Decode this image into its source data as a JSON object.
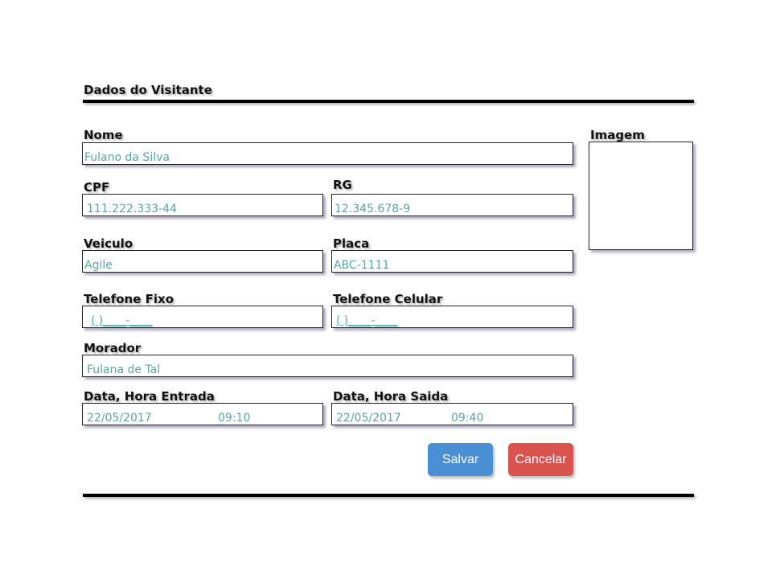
{
  "section_title": "Dados do Visitante",
  "image_label": "Imagem",
  "fields": {
    "nome": {
      "label": "Nome",
      "value": "Fulano da Silva"
    },
    "cpf": {
      "label": "CPF",
      "value": "111.222.333-44"
    },
    "rg": {
      "label": "RG",
      "value": "12.345.678-9"
    },
    "veiculo": {
      "label": "Veiculo",
      "value": "Agile"
    },
    "placa": {
      "label": "Placa",
      "value": "ABC-1111"
    },
    "telefone_fixo": {
      "label": "Telefone Fixo",
      "value": "( )____-____"
    },
    "telefone_celular": {
      "label": "Telefone Celular",
      "value": "( )____-____"
    },
    "morador": {
      "label": "Morador",
      "value": "Fulana de Tal"
    },
    "entrada": {
      "label": "Data, Hora Entrada",
      "date": "22/05/2017",
      "time": "09:10"
    },
    "saida": {
      "label": "Data, Hora Saida",
      "date": "22/05/2017",
      "time": "09:40"
    }
  },
  "buttons": {
    "save": {
      "label": "Salvar",
      "color": "#4a8fd4"
    },
    "cancel": {
      "label": "Cancelar",
      "color": "#d9534f"
    }
  }
}
